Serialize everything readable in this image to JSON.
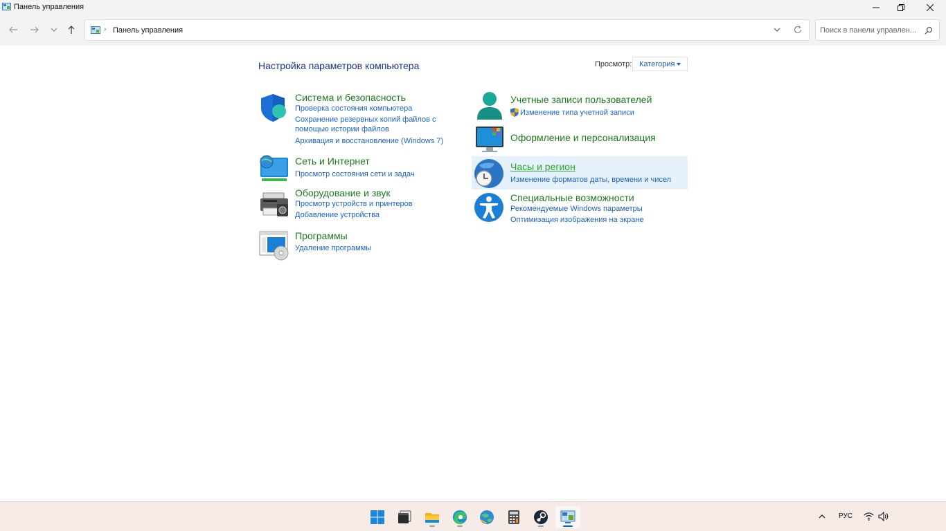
{
  "window": {
    "title": "Панель управления"
  },
  "navigation": {
    "breadcrumb": "Панель управления",
    "search_placeholder": "Поиск в панели управлен..."
  },
  "content": {
    "heading": "Настройка параметров компьютера",
    "view_label": "Просмотр:",
    "view_value": "Категория",
    "left_categories": [
      {
        "title": "Система и безопасность",
        "icon": "shield-icon",
        "links": [
          "Проверка состояния компьютера",
          "Сохранение резервных копий файлов с",
          "помощью истории файлов",
          "Архивация и восстановление (Windows 7)"
        ]
      },
      {
        "title": "Сеть и Интернет",
        "icon": "network-globe-icon",
        "links": [
          "Просмотр состояния сети и задач"
        ]
      },
      {
        "title": "Оборудование и звук",
        "icon": "printer-icon",
        "links": [
          "Просмотр устройств и принтеров",
          "Добавление устройства"
        ]
      },
      {
        "title": "Программы",
        "icon": "programs-icon",
        "links": [
          "Удаление программы"
        ]
      }
    ],
    "right_categories": [
      {
        "title": "Учетные записи пользователей",
        "icon": "user-icon",
        "links": [
          "Изменение типа учетной записи"
        ]
      },
      {
        "title": "Оформление и персонализация",
        "icon": "monitor-personalization-icon",
        "links": []
      },
      {
        "title": "Часы и регион",
        "icon": "clock-globe-icon",
        "links": [
          "Изменение форматов даты, времени и чисел"
        ]
      },
      {
        "title": "Специальные возможности",
        "icon": "accessibility-icon",
        "links": [
          "Рекомендуемые Windows параметры",
          "Оптимизация изображения на экране"
        ]
      }
    ]
  },
  "taskbar": {
    "apps": [
      "start-icon",
      "terminal-icon",
      "file-explorer-icon",
      "edge-icon",
      "maps-icon",
      "calculator-icon",
      "steam-icon",
      "control-panel-icon"
    ],
    "language": "РУС"
  },
  "colors": {
    "heading": "#1e3287",
    "category_title": "#1e7a1e",
    "link": "#1a62c6",
    "highlight": "#e5f1fb",
    "taskbar": "#f6ebe6"
  }
}
